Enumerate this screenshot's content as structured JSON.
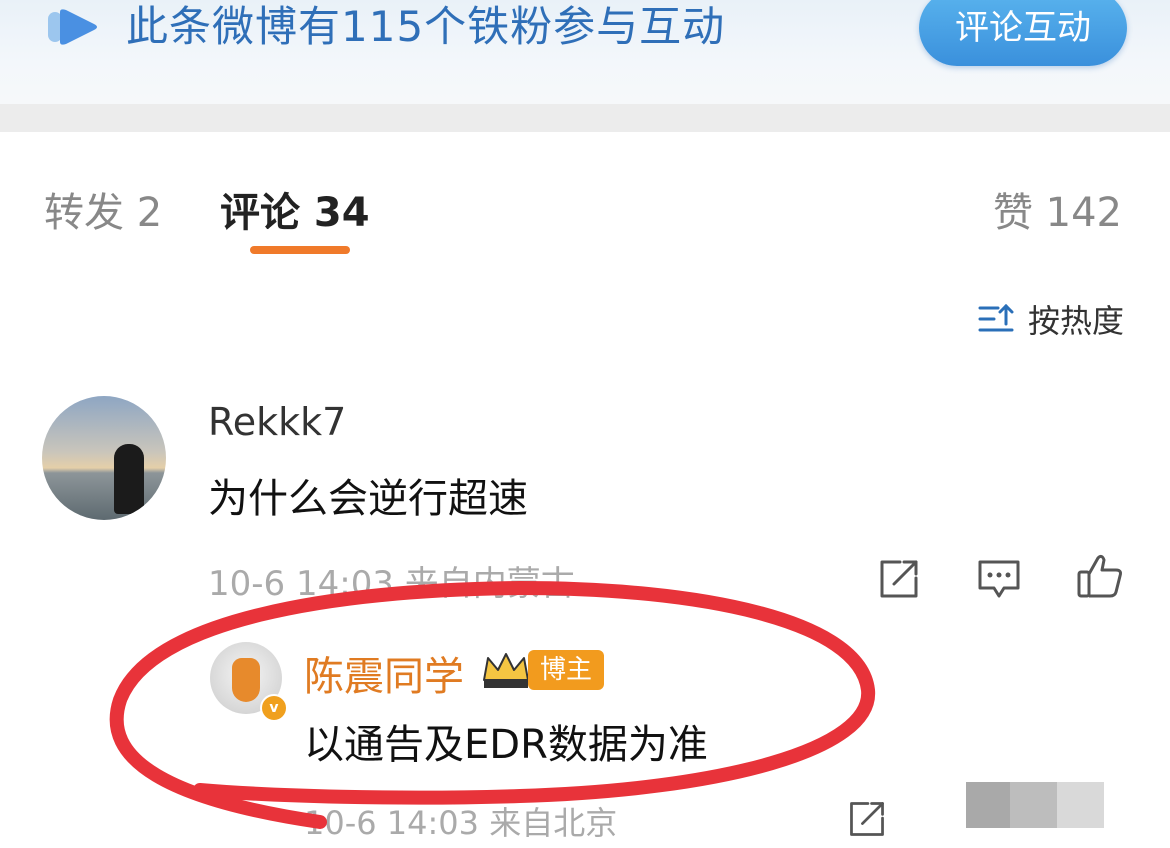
{
  "banner": {
    "text": "此条微博有115个铁粉参与互动",
    "button_label": "评论互动",
    "accent": "#2f6fb8"
  },
  "tabs": {
    "repost": "转发 2",
    "comment": "评论 34",
    "like": "赞 142",
    "active_color": "#f07a2a"
  },
  "sort": {
    "label": "按热度"
  },
  "comment": {
    "author": "Rekkk7",
    "text": "为什么会逆行超速",
    "meta": "10-6 14:03 来自内蒙古"
  },
  "reply": {
    "author": "陈震同学",
    "badge": "博主",
    "text": "以通告及EDR数据为准",
    "meta": "10-6 14:03 来自北京",
    "name_color": "#e07b22"
  },
  "icons": [
    "share-icon",
    "reply-icon",
    "like-icon",
    "sort-icon",
    "crown-icon",
    "verified-icon"
  ]
}
